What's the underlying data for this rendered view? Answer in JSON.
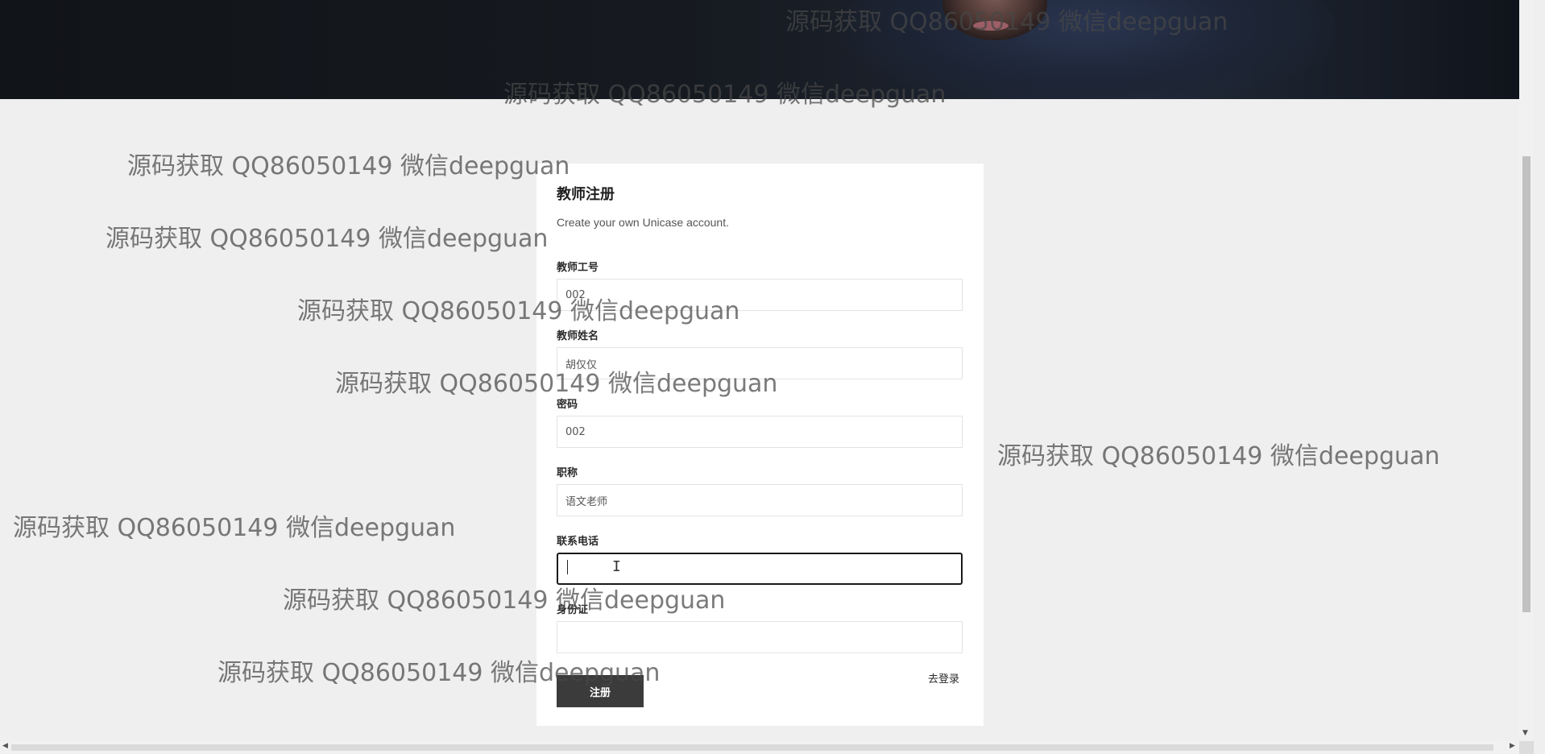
{
  "form": {
    "title": "教师注册",
    "subtitle": "Create your own Unicase account.",
    "fields": [
      {
        "label": "教师工号",
        "value": "002"
      },
      {
        "label": "教师姓名",
        "value": "胡仅仅"
      },
      {
        "label": "密码",
        "value": "002"
      },
      {
        "label": "职称",
        "value": "语文老师"
      },
      {
        "label": "联系电话",
        "value": ""
      },
      {
        "label": "身份证",
        "value": ""
      }
    ],
    "submit_label": "注册",
    "login_link": "去登录"
  },
  "watermarks": {
    "text": "源码获取 QQ86050149 微信deepguan"
  },
  "scrollbar": {
    "up_arrow": "▲",
    "down_arrow": "▼",
    "left_arrow": "◀",
    "right_arrow": "▶"
  },
  "colors": {
    "page_background": "#efefef",
    "card_background": "#ffffff",
    "button_background": "#3b3b3b",
    "hero_background": "#111418"
  }
}
